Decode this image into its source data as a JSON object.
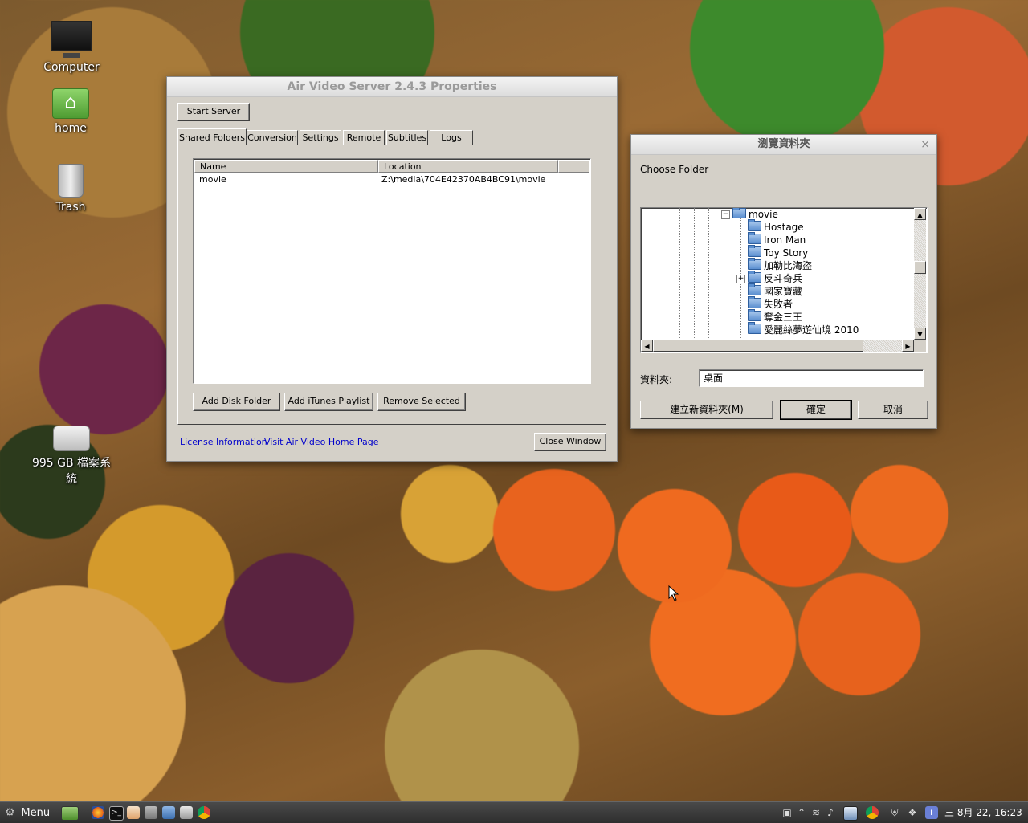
{
  "desktop": {
    "icons": [
      {
        "label": "Computer"
      },
      {
        "label": "home"
      },
      {
        "label": "Trash"
      },
      {
        "label": "995 GB 檔案系統"
      }
    ]
  },
  "airvideo": {
    "title": "Air Video Server 2.4.3 Properties",
    "start_button": "Start Server",
    "tabs": [
      "Shared Folders",
      "Conversion",
      "Settings",
      "Remote",
      "Subtitles",
      "Logs"
    ],
    "table": {
      "columns": [
        "Name",
        "Location"
      ],
      "rows": [
        {
          "name": "movie",
          "location": "Z:\\media\\704E42370AB4BC91\\movie"
        }
      ]
    },
    "buttons": {
      "add_disk": "Add Disk Folder",
      "add_itunes": "Add iTunes Playlist",
      "remove": "Remove Selected",
      "close": "Close Window"
    },
    "links": {
      "license": "License Information",
      "homepage": "Visit Air Video Home Page"
    }
  },
  "browse": {
    "title": "瀏覽資料夾",
    "close_glyph": "×",
    "prompt": "Choose Folder",
    "tree": {
      "root": "movie",
      "children": [
        "Hostage",
        "Iron Man",
        "Toy Story",
        "加勒比海盜",
        "反斗奇兵",
        "國家寶藏",
        "失敗者",
        "奪金三王",
        "愛麗絲夢遊仙境 2010"
      ]
    },
    "folder_label": "資料夾:",
    "folder_value": "桌面",
    "buttons": {
      "new_folder": "建立新資料夾(M)",
      "ok": "確定",
      "cancel": "取消"
    }
  },
  "taskbar": {
    "menu_label": "Menu",
    "clock": "三 8月 22, 16:23"
  }
}
